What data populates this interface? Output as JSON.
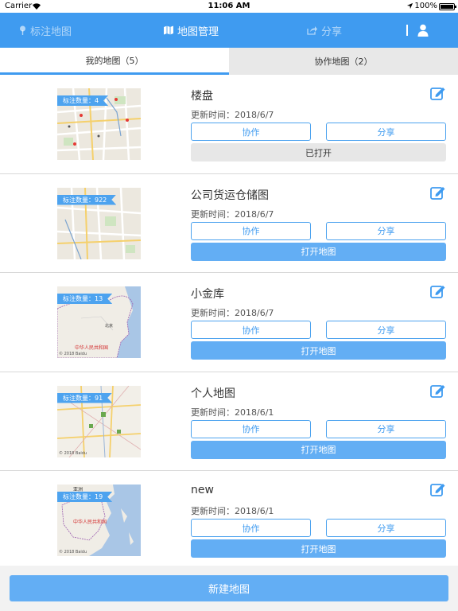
{
  "status_bar": {
    "carrier": "Carrier",
    "time": "11:06 AM",
    "battery": "100%"
  },
  "navbar": {
    "mark_label": "标注地图",
    "maps_label": "地图管理",
    "share_label": "分享",
    "icons": {
      "mark": "map-pin-icon",
      "maps": "map-icon",
      "share": "share-icon",
      "user": "user-icon"
    }
  },
  "tabs": [
    {
      "label": "我的地图（5）",
      "active": true
    },
    {
      "label": "协作地图（2）",
      "active": false
    }
  ],
  "labels": {
    "count_label": "标注数量：",
    "updated_label": "更新时间：",
    "collab": "协作",
    "share": "分享"
  },
  "maps": [
    {
      "name": "楼盘",
      "count": "4",
      "updated": "2018/6/7",
      "open_label": "已打开",
      "opened": true,
      "thumb_style": "city"
    },
    {
      "name": "公司货运仓储图",
      "count": "922",
      "updated": "2018/6/7",
      "open_label": "打开地图",
      "opened": false,
      "thumb_style": "city"
    },
    {
      "name": "小金库",
      "count": "13",
      "updated": "2018/6/7",
      "open_label": "打开地图",
      "opened": false,
      "thumb_style": "country",
      "map_text": [
        "北京",
        "中华人民共和国"
      ],
      "copyright": "© 2018 Baidu"
    },
    {
      "name": "个人地图",
      "count": "91",
      "updated": "2018/6/1",
      "open_label": "打开地图",
      "opened": false,
      "thumb_style": "region",
      "copyright": "© 2018 Baidu"
    },
    {
      "name": "new",
      "count": "19",
      "updated": "2018/6/1",
      "open_label": "打开地图",
      "opened": false,
      "thumb_style": "asia",
      "map_text": [
        "亚洲",
        "中华人民共和国"
      ],
      "copyright": "© 2018 Baidu"
    }
  ],
  "footer": {
    "new_map_label": "新建地图"
  },
  "colors": {
    "primary": "#3f9bf0",
    "button_fill": "#63aef4",
    "opened_fill": "#e7e7e7"
  }
}
